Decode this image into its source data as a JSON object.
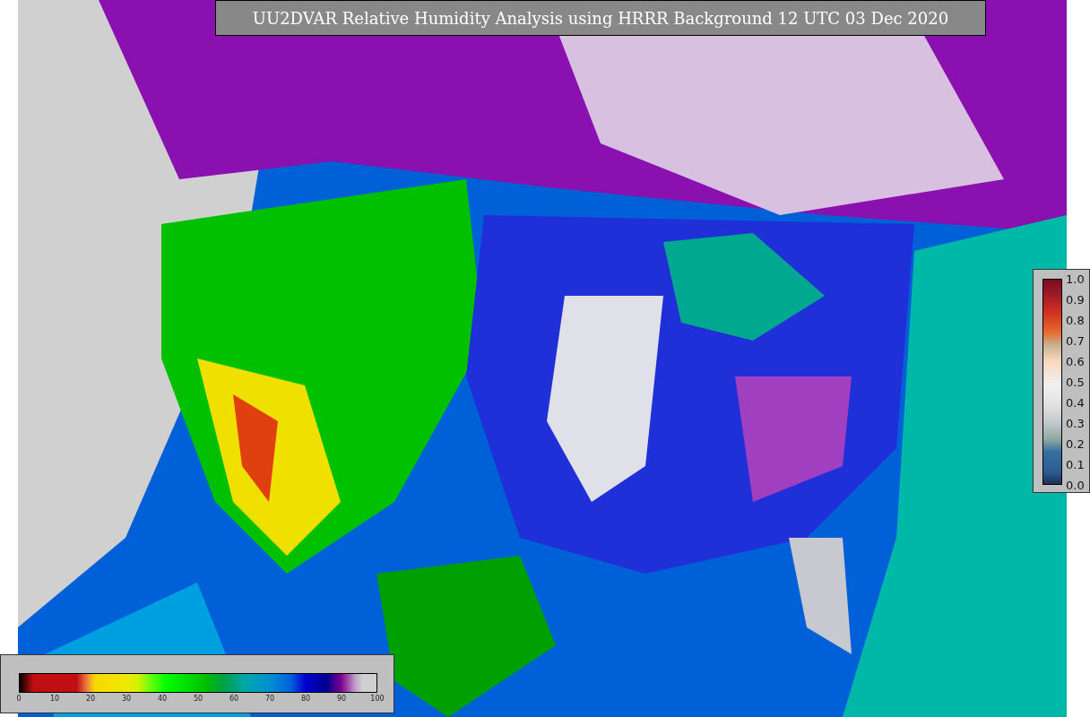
{
  "title": "UU2DVAR Relative Humidity Analysis using HRRR Background 12 UTC 03 Dec 2020",
  "humidity_colorbar": {
    "ticks": [
      "0",
      "10",
      "20",
      "30",
      "40",
      "50",
      "60",
      "70",
      "80",
      "90",
      "100"
    ]
  },
  "observation_colorbar": {
    "ticks": [
      "1.0",
      "0.9",
      "0.8",
      "0.7",
      "0.6",
      "0.5",
      "0.4",
      "0.3",
      "0.2",
      "0.1",
      "0.0"
    ]
  }
}
